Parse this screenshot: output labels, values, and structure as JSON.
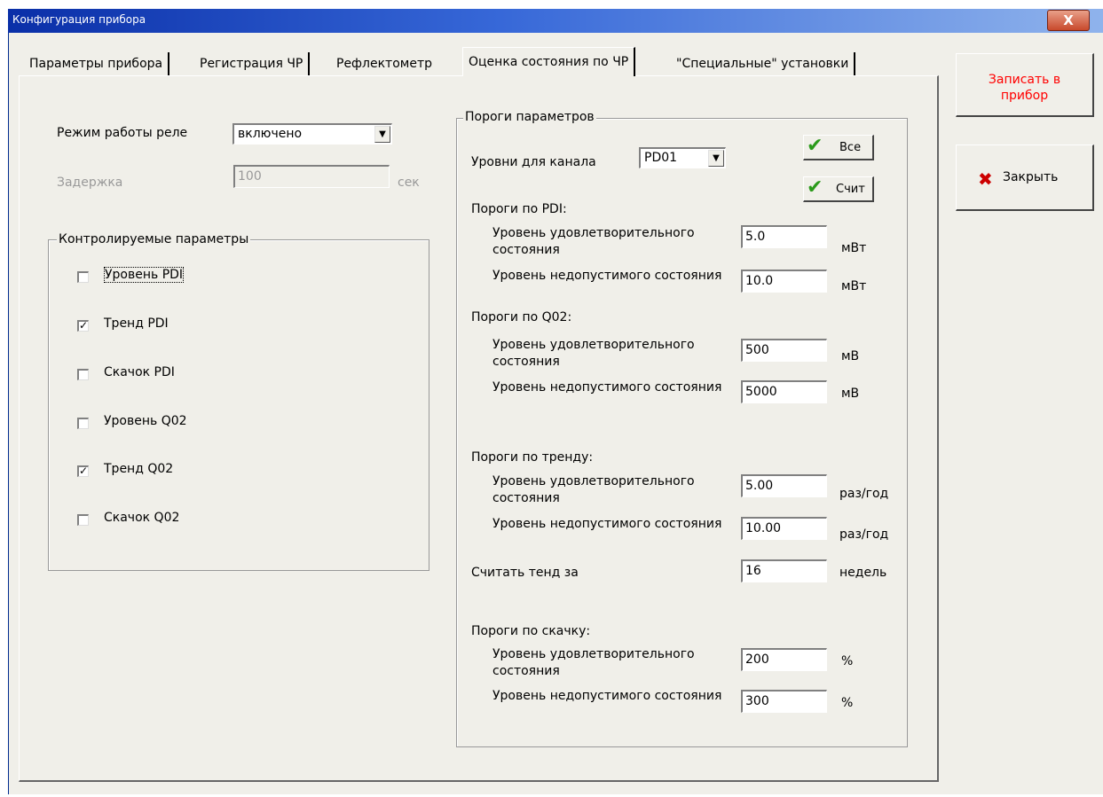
{
  "window": {
    "title": "Конфигурация прибора",
    "close": "X"
  },
  "tabs": [
    "Параметры прибора",
    "Регистрация ЧР",
    "Рефлектометр",
    "Оценка состояния по ЧР",
    "\"Специальные\" установки"
  ],
  "side_buttons": {
    "write": "Записать в прибор",
    "close": "Закрыть"
  },
  "relay": {
    "label": "Режим работы реле",
    "value": "включено"
  },
  "delay": {
    "label": "Задержка",
    "value": "100",
    "unit": "сек"
  },
  "controlled": {
    "title": "Контролируемые параметры",
    "items": [
      {
        "label": "Уровень PDI",
        "checked": false
      },
      {
        "label": "Тренд PDI",
        "checked": true
      },
      {
        "label": "Скачок PDI",
        "checked": false
      },
      {
        "label": "Уровень Q02",
        "checked": false
      },
      {
        "label": "Тренд Q02",
        "checked": true
      },
      {
        "label": "Скачок Q02",
        "checked": false
      }
    ]
  },
  "thresholds": {
    "title": "Пороги параметров",
    "channel_label": "Уровни для канала",
    "channel_value": "PD01",
    "btn_all": "Все",
    "btn_read": "Счит",
    "pdi": {
      "title": "Пороги по PDI:",
      "sat_label": "Уровень удовлетворительного состояния",
      "sat_value": "5.0",
      "sat_unit": "мВт",
      "bad_label": "Уровень недопустимого состояния",
      "bad_value": "10.0",
      "bad_unit": "мВт"
    },
    "q02": {
      "title": "Пороги по Q02:",
      "sat_label": "Уровень удовлетворительного состояния",
      "sat_value": "500",
      "sat_unit": "мВ",
      "bad_label": "Уровень недопустимого состояния",
      "bad_value": "5000",
      "bad_unit": "мВ"
    },
    "trend": {
      "title": "Пороги по тренду:",
      "sat_label": "Уровень удовлетворительного состояния",
      "sat_value": "5.00",
      "sat_unit": "раз/год",
      "bad_label": "Уровень недопустимого состояния",
      "bad_value": "10.00",
      "bad_unit": "раз/год",
      "period_label": "Считать тенд за",
      "period_value": "16",
      "period_unit": "недель"
    },
    "jump": {
      "title": "Пороги по скачку:",
      "sat_label": "Уровень удовлетворительного состояния",
      "sat_value": "200",
      "sat_unit": "%",
      "bad_label": "Уровень недопустимого состояния",
      "bad_value": "300",
      "bad_unit": "%"
    }
  },
  "colors": {
    "title_bar": "#0a2fa8",
    "write_button_text": "#ff0000",
    "close_cross": "#cc0000",
    "check_green": "#2a9a1a"
  }
}
